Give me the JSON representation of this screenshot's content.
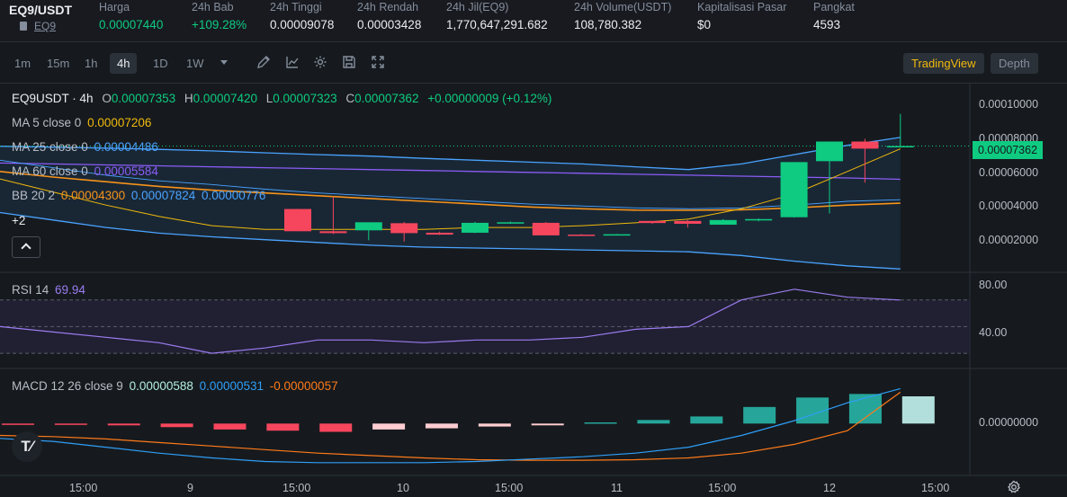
{
  "header": {
    "pair": "EQ9/USDT",
    "coin_link": "EQ9",
    "stats": [
      {
        "label": "Harga",
        "value": "0.00007440",
        "color": "green"
      },
      {
        "label": "24h Bab",
        "value": "+109.28%",
        "color": "green"
      },
      {
        "label": "24h Tinggi",
        "value": "0.00009078",
        "color": "white"
      },
      {
        "label": "24h Rendah",
        "value": "0.00003428",
        "color": "white"
      },
      {
        "label": "24h Jil(EQ9)",
        "value": "1,770,647,291.682",
        "color": "white"
      },
      {
        "label": "24h Volume(USDT)",
        "value": "108,780.382",
        "color": "white"
      },
      {
        "label": "Kapitalisasi Pasar",
        "value": "$0",
        "color": "white"
      },
      {
        "label": "Pangkat",
        "value": "4593",
        "color": "white"
      }
    ]
  },
  "toolbar": {
    "timeframes": [
      "1m",
      "15m",
      "1h",
      "4h",
      "1D",
      "1W"
    ],
    "active_timeframe": "4h",
    "tools": [
      "dropdown-icon",
      "pencil-icon",
      "line-chart-icon",
      "gear-icon",
      "save-icon",
      "fullscreen-icon"
    ],
    "tradingview_label": "TradingView",
    "depth_label": "Depth"
  },
  "legend": {
    "symbol": "EQ9USDT · 4h",
    "ohlc": {
      "o_label": "O",
      "o": "0.00007353",
      "h_label": "H",
      "h": "0.00007420",
      "l_label": "L",
      "l": "0.00007323",
      "c_label": "C",
      "c": "0.00007362",
      "change": "+0.00000009 (+0.12%)"
    },
    "ma5": {
      "label": "MA 5 close 0",
      "value": "0.00007206"
    },
    "ma25": {
      "label": "MA 25 close 0",
      "value": "0.00004486"
    },
    "ma60": {
      "label": "MA 60 close 0",
      "value": "0.00005584"
    },
    "bb": {
      "label": "BB 20 2",
      "mid": "0.00004300",
      "upper": "0.00007824",
      "lower": "0.00000776"
    },
    "more": "+2",
    "rsi": {
      "label": "RSI 14",
      "value": "69.94"
    },
    "macd": {
      "label": "MACD 12 26 close 9",
      "macd": "0.00000588",
      "signal": "0.00000531",
      "hist": "-0.00000057"
    }
  },
  "price_axis": {
    "labels": [
      "0.00010000",
      "0.00008000",
      "0.00006000",
      "0.00004000",
      "0.00002000"
    ],
    "current": "0.00007362"
  },
  "rsi_axis": {
    "labels": [
      "80.00",
      "40.00"
    ]
  },
  "macd_axis": {
    "labels": [
      "0.00000000"
    ]
  },
  "time_axis": {
    "labels": [
      "15:00",
      "9",
      "15:00",
      "10",
      "15:00",
      "11",
      "15:00",
      "12",
      "15:00"
    ]
  },
  "logo_text": "T⁄",
  "colors": {
    "up": "#0ecb81",
    "down": "#f6465d",
    "ma5": "#f0b90b",
    "ma25": "#4aa3ff",
    "ma60": "#8b5cf6",
    "bb_mid": "#f7931a",
    "rsi": "#9b7cf0",
    "macd": "#2f9ef7",
    "signal": "#ff7a1a",
    "accent": "#f0b90b"
  },
  "chart_data": {
    "type": "candlestick",
    "interval": "4h",
    "candles": [
      {
        "o": 3.99e-05,
        "h": 4e-05,
        "l": 2.8e-05,
        "c": 2.8e-05
      },
      {
        "o": 2.8e-05,
        "h": 4.65e-05,
        "l": 2.65e-05,
        "c": 2.7e-05
      },
      {
        "o": 2.85e-05,
        "h": 3e-05,
        "l": 2.32e-05,
        "c": 3.28e-05
      },
      {
        "o": 3.23e-05,
        "h": 3.3e-05,
        "l": 2.25e-05,
        "c": 2.7e-05
      },
      {
        "o": 2.72e-05,
        "h": 2.78e-05,
        "l": 2.6e-05,
        "c": 2.62e-05
      },
      {
        "o": 2.72e-05,
        "h": 3.3e-05,
        "l": 2.7e-05,
        "c": 3.25e-05
      },
      {
        "o": 3.25e-05,
        "h": 3.32e-05,
        "l": 3.2e-05,
        "c": 3.28e-05
      },
      {
        "o": 3.25e-05,
        "h": 3.3e-05,
        "l": 2.58e-05,
        "c": 2.58e-05
      },
      {
        "o": 2.62e-05,
        "h": 2.65e-05,
        "l": 2.55e-05,
        "c": 2.58e-05
      },
      {
        "o": 2.62e-05,
        "h": 2.65e-05,
        "l": 2.58e-05,
        "c": 2.64e-05
      },
      {
        "o": 3.35e-05,
        "h": 3.35e-05,
        "l": 3.2e-05,
        "c": 3.24e-05
      },
      {
        "o": 3.35e-05,
        "h": 3.4e-05,
        "l": 3e-05,
        "c": 3.2e-05
      },
      {
        "o": 3.15e-05,
        "h": 3.45e-05,
        "l": 3.15e-05,
        "c": 3.4e-05
      },
      {
        "o": 3.4e-05,
        "h": 3.48e-05,
        "l": 3.33e-05,
        "c": 3.45e-05
      },
      {
        "o": 3.55e-05,
        "h": 6.5e-05,
        "l": 3.53e-05,
        "c": 6.5e-05
      },
      {
        "o": 6.55e-05,
        "h": 7.6e-05,
        "l": 3.75e-05,
        "c": 7.6e-05
      },
      {
        "o": 7.6e-05,
        "h": 7.75e-05,
        "l": 5.4e-05,
        "c": 7.22e-05
      },
      {
        "o": 7.35e-05,
        "h": 9.08e-05,
        "l": 7.32e-05,
        "c": 7.36e-05
      }
    ],
    "price_ylim": [
      6.5e-06,
      0.0001075
    ],
    "ma5": [
      5.6e-05,
      4.9e-05,
      4.2e-05,
      3.6e-05,
      3.1e-05,
      2.9e-05,
      2.9e-05,
      2.9e-05,
      2.9e-05,
      3e-05,
      3e-05,
      3.1e-05,
      3.25e-05,
      3.45e-05,
      4e-05,
      4.8e-05,
      6e-05,
      7.21e-05
    ],
    "ma25": [
      6.6e-05,
      6.2e-05,
      5.8e-05,
      5.5e-05,
      5.3e-05,
      5.05e-05,
      4.85e-05,
      4.7e-05,
      4.55e-05,
      4.4e-05,
      4.25e-05,
      4.15e-05,
      4.05e-05,
      4e-05,
      4.05e-05,
      4.2e-05,
      4.4e-05,
      4.49e-05
    ],
    "ma60": [
      6.45e-05,
      6.4e-05,
      6.35e-05,
      6.3e-05,
      6.25e-05,
      6.2e-05,
      6.15e-05,
      6.1e-05,
      6.05e-05,
      6e-05,
      5.95e-05,
      5.9e-05,
      5.85e-05,
      5.8e-05,
      5.75e-05,
      5.7e-05,
      5.65e-05,
      5.58e-05
    ],
    "bb_upper": [
      7.35e-05,
      7.3e-05,
      7.25e-05,
      7.18e-05,
      7.1e-05,
      7e-05,
      6.9e-05,
      6.82e-05,
      6.7e-05,
      6.6e-05,
      6.5e-05,
      6.4e-05,
      6.25e-05,
      6.1e-05,
      6.4e-05,
      6.9e-05,
      7.4e-05,
      7.82e-05
    ],
    "bb_mid": [
      6e-05,
      5.7e-05,
      5.45e-05,
      5.2e-05,
      5e-05,
      4.85e-05,
      4.7e-05,
      4.55e-05,
      4.4e-05,
      4.25e-05,
      4.1e-05,
      4e-05,
      3.93e-05,
      3.92e-05,
      3.95e-05,
      4.05e-05,
      4.2e-05,
      4.3e-05
    ],
    "bb_lower": [
      3.8e-05,
      3.4e-05,
      3e-05,
      2.7e-05,
      2.5e-05,
      2.35e-05,
      2.2e-05,
      2.05e-05,
      1.95e-05,
      1.9e-05,
      1.85e-05,
      1.8e-05,
      1.75e-05,
      1.7e-05,
      1.5e-05,
      1.2e-05,
      9.5e-06,
      7.8e-06
    ],
    "rsi": [
      50,
      46,
      42,
      38,
      30,
      34,
      40,
      40,
      38,
      40,
      40,
      42,
      48,
      50,
      70,
      78,
      72,
      69.94
    ],
    "rsi_ylim": [
      20,
      90
    ],
    "macd_hist": [
      -2e-07,
      -2e-07,
      -3e-07,
      -6e-07,
      -1e-06,
      -1.2e-06,
      -1.4e-06,
      -1e-06,
      -8e-07,
      -5e-07,
      -3e-07,
      2e-07,
      6e-07,
      1.2e-06,
      2.8e-06,
      4.4e-06,
      5e-06,
      4.6e-06
    ],
    "macd": [
      -2.5e-06,
      -3e-06,
      -4e-06,
      -5e-06,
      -5.8e-06,
      -6.4e-06,
      -6.6e-06,
      -6.6e-06,
      -6.6e-06,
      -6.4e-06,
      -6e-06,
      -5.6e-06,
      -5e-06,
      -4e-06,
      -2e-06,
      5e-07,
      3.5e-06,
      5.9e-06
    ],
    "signal": [
      -2e-06,
      -2.2e-06,
      -2.6e-06,
      -3.2e-06,
      -3.8e-06,
      -4.4e-06,
      -5e-06,
      -5.4e-06,
      -5.8e-06,
      -6.1e-06,
      -6.2e-06,
      -6.2e-06,
      -6.1e-06,
      -5.8e-06,
      -5e-06,
      -3.5e-06,
      -1.2e-06,
      5.3e-06
    ],
    "macd_ylim": [
      -8e-06,
      9e-06
    ]
  }
}
